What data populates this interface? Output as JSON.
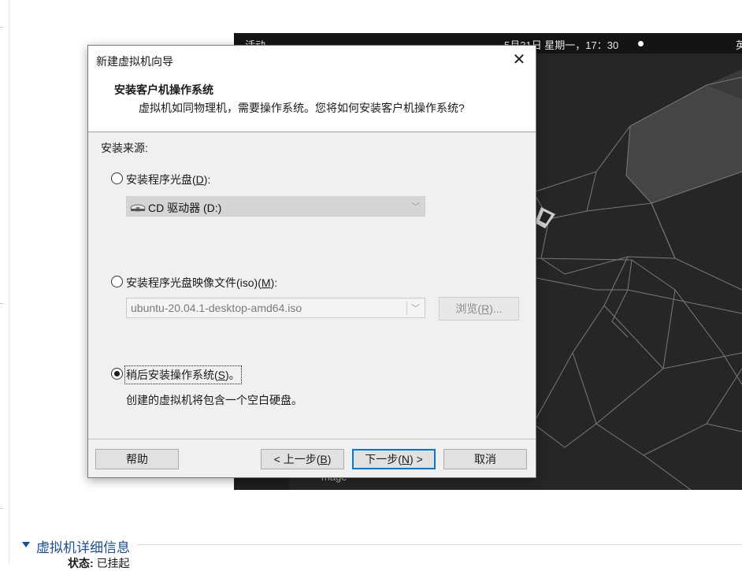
{
  "vm_screen": {
    "activities": "活动",
    "clock": "5月31日 星期一，17：30",
    "top_right": "英",
    "dock_label": "mage"
  },
  "dialog": {
    "window_title": "新建虚拟机向导",
    "close_glyph": "✕",
    "heading": "安装客户机操作系统",
    "subheading": "虚拟机如同物理机，需要操作系统。您将如何安装客户机操作系统?",
    "source_label": "安装来源:",
    "options": [
      {
        "label_text": "安装程序光盘(",
        "mnemonic": "D",
        "label_tail": "):",
        "checked": false
      },
      {
        "label_text": "安装程序光盘映像文件(iso)(",
        "mnemonic": "M",
        "label_tail": "):",
        "checked": false
      },
      {
        "label_text": "稍后安装操作系统(",
        "mnemonic": "S",
        "label_tail": ")。",
        "checked": true
      }
    ],
    "cd_drive_value": "CD 驱动器 (D:)",
    "iso_path_value": "ubuntu-20.04.1-desktop-amd64.iso",
    "browse": {
      "text": "浏览(",
      "mnemonic": "R",
      "tail": ")..."
    },
    "later_note": "创建的虚拟机将包含一个空白硬盘。",
    "buttons": {
      "help": "帮助",
      "back": {
        "text": "< 上一步(",
        "mnemonic": "B",
        "tail": ")"
      },
      "next": {
        "text": "下一步(",
        "mnemonic": "N",
        "tail": ") >"
      },
      "cancel": "取消"
    }
  },
  "host": {
    "details_title": "虚拟机详细信息",
    "status_label": "状态:",
    "status_value": "已挂起"
  },
  "colors": {
    "accent_blue": "#0078d7",
    "details_blue": "#1a4f96",
    "vm_background": "#252525"
  }
}
